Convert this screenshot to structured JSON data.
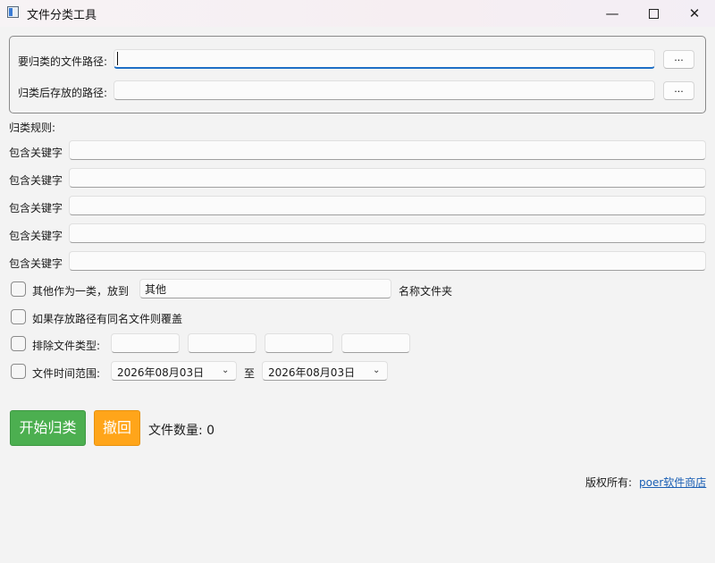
{
  "window": {
    "title": "文件分类工具",
    "min_label": "—",
    "close_label": "✕"
  },
  "paths": {
    "source_label": "要归类的文件路径:",
    "source_value": "",
    "target_label": "归类后存放的路径:",
    "target_value": "",
    "browse_label": "..."
  },
  "rules": {
    "heading": "归类规则:",
    "items": [
      {
        "label": "包含关键字",
        "value": ""
      },
      {
        "label": "包含关键字",
        "value": ""
      },
      {
        "label": "包含关键字",
        "value": ""
      },
      {
        "label": "包含关键字",
        "value": ""
      },
      {
        "label": "包含关键字",
        "value": ""
      }
    ]
  },
  "options": {
    "others_label": "其他作为一类，放到",
    "others_value": "其他",
    "others_suffix": "名称文件夹",
    "overwrite_label": "如果存放路径有同名文件则覆盖",
    "exclude_label": "排除文件类型:",
    "exclude_values": [
      "",
      "",
      "",
      ""
    ],
    "time_label": "文件时间范围:",
    "date_from": "2026年08月03日",
    "date_to_label": "至",
    "date_to": "2026年08月03日"
  },
  "actions": {
    "start_label": "开始归类",
    "undo_label": "撤回",
    "count_text": "文件数量: 0",
    "start_color": "#4caf50",
    "undo_color": "#ffa51a"
  },
  "footer": {
    "copyright_label": "版权所有:",
    "link_text": "poer软件商店"
  }
}
